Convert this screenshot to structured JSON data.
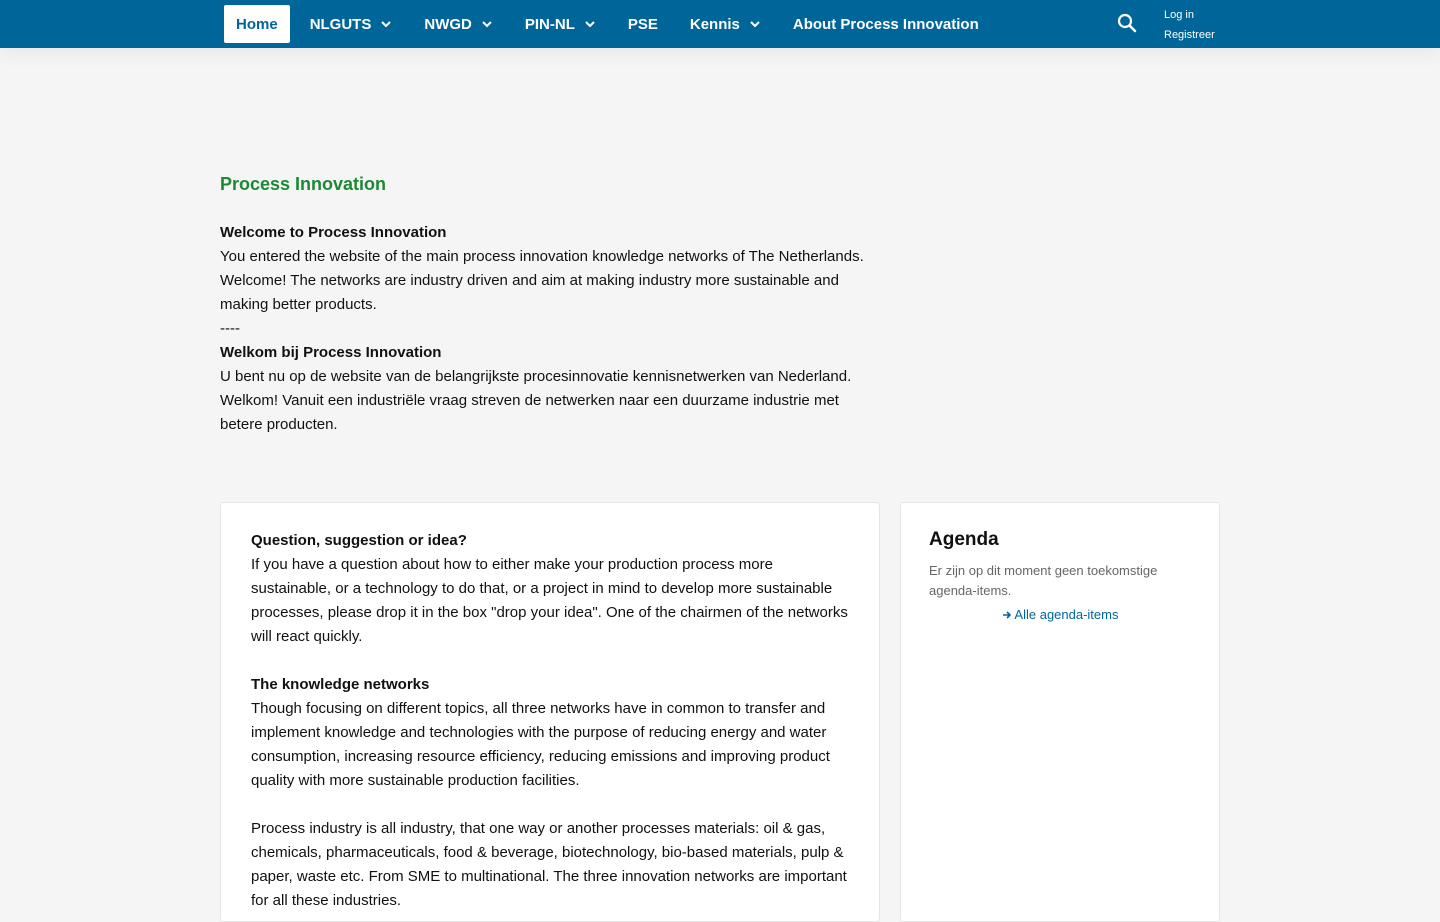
{
  "nav": {
    "items": [
      {
        "label": "Home",
        "dropdown": false,
        "active": true
      },
      {
        "label": "NLGUTS",
        "dropdown": true
      },
      {
        "label": "NWGD",
        "dropdown": true
      },
      {
        "label": "PIN-NL",
        "dropdown": true
      },
      {
        "label": "PSE",
        "dropdown": false
      },
      {
        "label": "Kennis",
        "dropdown": true
      },
      {
        "label": "About Process Innovation",
        "dropdown": false
      }
    ],
    "search_icon": "search-icon",
    "login_label": "Log in",
    "register_label": "Registreer"
  },
  "intro": {
    "title": "Process Innovation",
    "en_heading": "Welcome to Process Innovation",
    "en_text": "You entered the website of the main process innovation knowledge networks of The Netherlands. Welcome! The networks are industry driven and aim at making industry more sustainable and making better products.",
    "separator": "----",
    "nl_heading": "Welkom bij Process Innovation",
    "nl_text": "U bent nu op de website van de belangrijkste procesinnovatie kennisnetwerken van Nederland. Welkom! Vanuit een industriële vraag streven de netwerken naar een duurzame industrie met betere producten."
  },
  "main": {
    "question_heading": "Question, suggestion or idea?",
    "question_text": "If you have a question about how to either make your production process  more sustainable, or a technology to do that, or a project in mind to  develop more sustainable processes, please drop it in the box \"drop your  idea\". One of the chairmen of the networks will react quickly.",
    "networks_heading": "The knowledge networks",
    "networks_text": "Though focusing on different topics, all three networks have in common  to transfer and implement knowledge and technologies with the purpose of  reducing energy and water consumption, increasing resource efficiency,  reducing emissions and improving product quality with more sustainable  production facilities.",
    "industry_text": "Process industry is all industry, that one way or another processes  materials: oil & gas, chemicals, pharmaceuticals, food &  beverage, biotechnology, bio-based materials, pulp & paper, waste  etc. From SME to multinational. The three innovation networks are  important for all these industries."
  },
  "agenda": {
    "title": "Agenda",
    "empty_text": "Er zijn op dit moment geen toekomstige agenda-items.",
    "link_label": "Alle agenda-items",
    "link_icon": "arrow-right-icon"
  },
  "colors": {
    "nav_bg": "#006699",
    "title_green": "#1a8a33",
    "link_blue": "#006699",
    "page_bg": "#f5f5f5"
  }
}
